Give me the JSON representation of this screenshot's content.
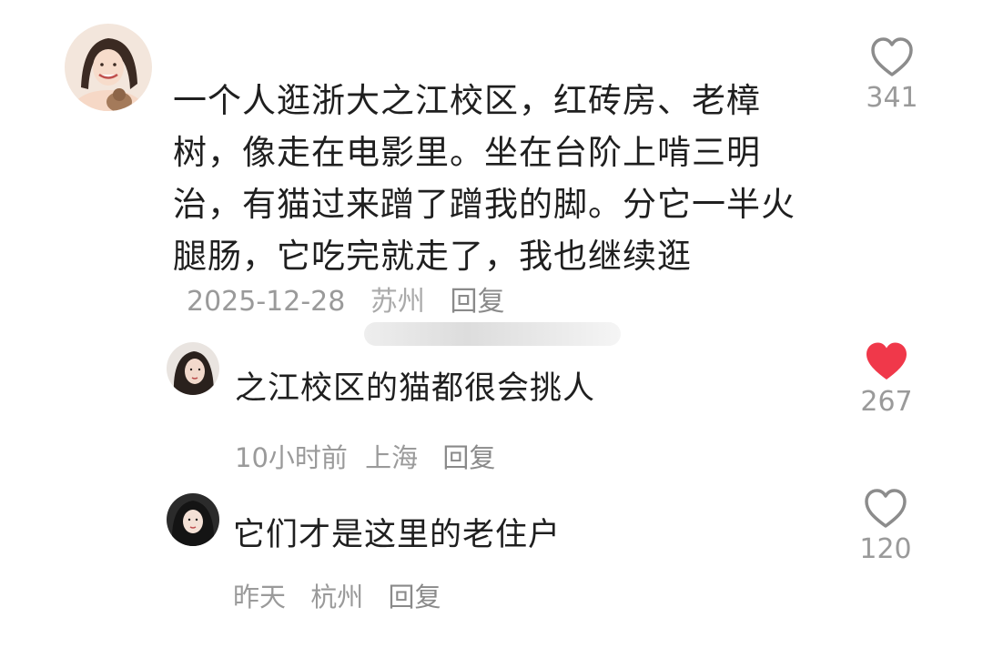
{
  "comment": {
    "text": "一个人逛浙大之江校区，红砖房、老樟树，像走在电影里。坐在台阶上啃三明治，有猫过来蹭了蹭我的脚。分它一半火腿肠，它吃完就走了，我也继续逛",
    "date": "2025-12-28",
    "location": "苏州",
    "reply_label": "回复",
    "likes": "341",
    "liked": false
  },
  "replies": [
    {
      "text": "之江校区的猫都很会挑人",
      "time": "10小时前",
      "location": "上海",
      "reply_label": "回复",
      "likes": "267",
      "liked": true
    },
    {
      "text": "它们才是这里的老住户",
      "time": "昨天",
      "location": "杭州",
      "reply_label": "回复",
      "likes": "120",
      "liked": false
    }
  ],
  "colors": {
    "liked_heart": "#f0384a",
    "unliked_heart": "#8c8c8c"
  },
  "icons": {
    "like": "heart-icon",
    "liked": "heart-filled-icon"
  }
}
